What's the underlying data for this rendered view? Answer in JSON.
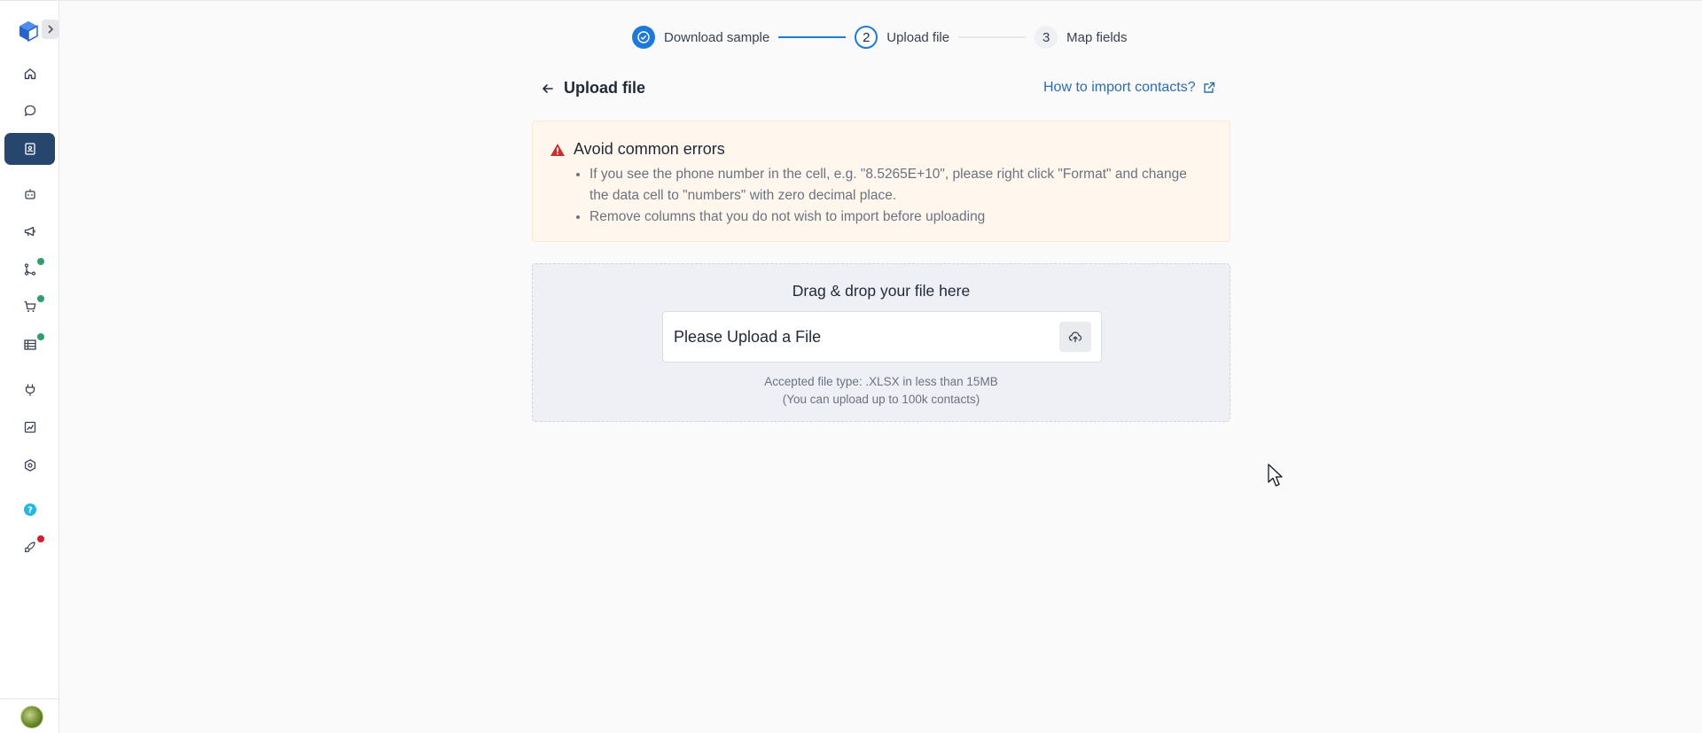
{
  "colors": {
    "accent": "#1e7ad6",
    "nav_active": "#27466e",
    "link": "#2b6cb0",
    "warning_bg": "#fff7ed",
    "warning_icon": "#c53030",
    "dot_green": "#2f9e6e",
    "dot_red": "#d0202e"
  },
  "sidebar": {
    "logo_icon": "cube-logo-icon",
    "expand_icon": "chevron-right-icon",
    "items": [
      {
        "icon": "home-icon",
        "active": false
      },
      {
        "icon": "chat-bubble-icon",
        "active": false
      },
      {
        "icon": "contacts-book-icon",
        "active": true
      },
      {
        "icon": "bot-icon",
        "active": false
      },
      {
        "icon": "megaphone-icon",
        "active": false
      },
      {
        "icon": "workflow-icon",
        "active": false,
        "badge": "green"
      },
      {
        "icon": "cart-icon",
        "active": false,
        "badge": "green"
      },
      {
        "icon": "table-icon",
        "active": false,
        "badge": "green"
      },
      {
        "icon": "plug-icon",
        "active": false
      },
      {
        "icon": "analytics-icon",
        "active": false
      },
      {
        "icon": "settings-icon",
        "active": false
      },
      {
        "icon": "help-icon",
        "active": false
      },
      {
        "icon": "rocket-icon",
        "active": false,
        "badge": "red"
      }
    ]
  },
  "stepper": {
    "steps": [
      {
        "number": "1",
        "label": "Download sample",
        "state": "done"
      },
      {
        "number": "2",
        "label": "Upload file",
        "state": "current"
      },
      {
        "number": "3",
        "label": "Map fields",
        "state": "future"
      }
    ]
  },
  "header": {
    "title": "Upload file",
    "help_link": "How to import contacts?"
  },
  "warning": {
    "title": "Avoid common errors",
    "items": [
      "If you see the phone number in the cell, e.g. \"8.5265E+10\", please right click \"Format\" and change the data cell to \"numbers\" with zero decimal place.",
      "Remove columns that you do not wish to import before uploading"
    ]
  },
  "upload": {
    "title": "Drag & drop your file here",
    "placeholder": "Please Upload a File",
    "accepted": "Accepted file type: .XLSX in less than 15MB",
    "limit": "(You can upload up to 100k contacts)"
  }
}
